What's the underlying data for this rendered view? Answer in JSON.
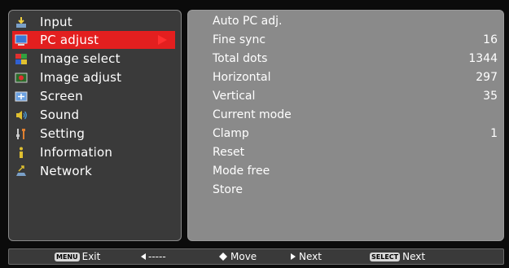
{
  "menu": {
    "items": [
      {
        "label": "Input",
        "icon": "input-icon"
      },
      {
        "label": "PC adjust",
        "icon": "pc-adjust-icon",
        "selected": true
      },
      {
        "label": "Image select",
        "icon": "image-select-icon"
      },
      {
        "label": "Image adjust",
        "icon": "image-adjust-icon"
      },
      {
        "label": "Screen",
        "icon": "screen-icon"
      },
      {
        "label": "Sound",
        "icon": "sound-icon"
      },
      {
        "label": "Setting",
        "icon": "setting-icon"
      },
      {
        "label": "Information",
        "icon": "information-icon"
      },
      {
        "label": "Network",
        "icon": "network-icon"
      }
    ]
  },
  "submenu": {
    "items": [
      {
        "label": "Auto PC adj.",
        "value": ""
      },
      {
        "label": "Fine sync",
        "value": "16"
      },
      {
        "label": "Total dots",
        "value": "1344"
      },
      {
        "label": "Horizontal",
        "value": "297"
      },
      {
        "label": "Vertical",
        "value": "35"
      },
      {
        "label": "Current mode",
        "value": ""
      },
      {
        "label": "Clamp",
        "value": "1"
      },
      {
        "label": "Reset",
        "value": ""
      },
      {
        "label": "Mode free",
        "value": ""
      },
      {
        "label": "Store",
        "value": ""
      }
    ]
  },
  "footer": {
    "menu_badge": "MENU",
    "exit_label": "Exit",
    "back_label": "-----",
    "move_label": "Move",
    "next_label": "Next",
    "select_badge": "SELECT",
    "select_next_label": "Next"
  },
  "colors": {
    "selected": "#e31f1f",
    "left_panel": "#3a3a3a",
    "right_panel": "#8a8a8a"
  }
}
